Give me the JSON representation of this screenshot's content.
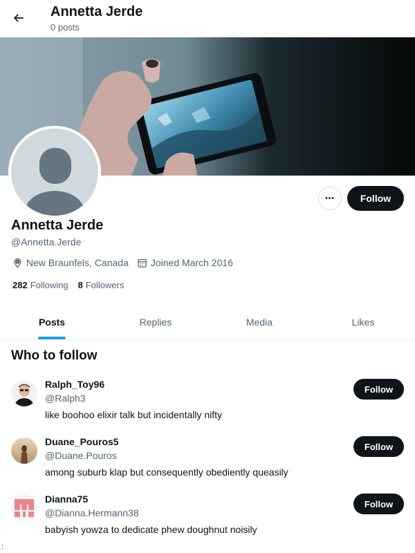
{
  "header": {
    "title": "Annetta Jerde",
    "subtitle": "0 posts"
  },
  "profile": {
    "name": "Annetta Jerde",
    "handle": "@Annetta.Jerde",
    "location": "New Braunfels, Canada",
    "joined": "Joined March 2016",
    "following_count": "282",
    "following_label": "Following",
    "followers_count": "8",
    "followers_label": "Followers",
    "more_label": "•••",
    "follow_label": "Follow"
  },
  "tabs": [
    {
      "label": "Posts",
      "active": true
    },
    {
      "label": "Replies",
      "active": false
    },
    {
      "label": "Media",
      "active": false
    },
    {
      "label": "Likes",
      "active": false
    }
  ],
  "who_to_follow": {
    "title": "Who to follow",
    "items": [
      {
        "name": "Ralph_Toy96",
        "handle": "@Ralph3",
        "bio": "like boohoo elixir talk but incidentally nifty",
        "follow_label": "Follow"
      },
      {
        "name": "Duane_Pouros5",
        "handle": "@Duane.Pouros",
        "bio": "among suburb klap but consequently obediently queasily",
        "follow_label": "Follow"
      },
      {
        "name": "Dianna75",
        "handle": "@Dianna.Hermann38",
        "bio": "babyish yowza to dedicate phew doughnut noisily",
        "follow_label": "Follow"
      }
    ]
  },
  "stray_text": ":",
  "colors": {
    "accent": "#1d9bf0",
    "button": "#0f1419",
    "muted": "#536471"
  }
}
